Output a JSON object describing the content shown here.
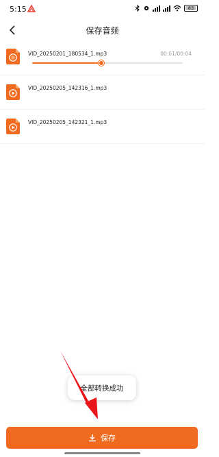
{
  "status_bar": {
    "time": "5:15",
    "signal_a": "5G",
    "signal_b": "5G",
    "battery": "83"
  },
  "header": {
    "title": "保存音频",
    "back_icon": "chevron-left-icon"
  },
  "files": [
    {
      "name": "VID_20250201_180534_1.mp3",
      "state": "playing",
      "icon": "pause-icon",
      "time": "00:01/00:04",
      "progress": 0.46
    },
    {
      "name": "VID_20250205_142316_1.mp3",
      "state": "stopped",
      "icon": "play-icon"
    },
    {
      "name": "VID_20250205_142321_1.mp3",
      "state": "stopped",
      "icon": "play-icon"
    }
  ],
  "toast": {
    "message": "全部转换成功"
  },
  "footer": {
    "save_label": "保存",
    "save_icon": "download-icon"
  },
  "colors": {
    "accent": "#f06b1f",
    "arrow": "#e8161b"
  }
}
